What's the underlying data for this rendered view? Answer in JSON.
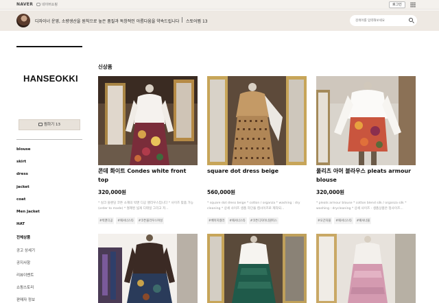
{
  "topbar": {
    "naver_label": "NAVER",
    "talk_label": "네이버쇼핑",
    "login_label": "로그인",
    "apps_icon": "grid-icon"
  },
  "header": {
    "description": "디자이너 운영, 소량생산을 원칙으로 높은 품질과 독창적인 아름다움을 약속드립니다",
    "follow_label": "스토어찜 13",
    "search_placeholder": "검색어를 입력해보세요",
    "search_icon": "search-icon"
  },
  "sidebar": {
    "brand": "HANSEOKKI",
    "favorite_label": "찜하기 13",
    "categories": [
      {
        "label": "blouse",
        "bold": true
      },
      {
        "label": "skirt",
        "bold": true
      },
      {
        "label": "dress",
        "bold": true
      },
      {
        "label": "jacket",
        "bold": true
      },
      {
        "label": "coat",
        "bold": true
      },
      {
        "label": "Men Jacket",
        "bold": true
      },
      {
        "label": "HAT",
        "bold": true
      },
      {
        "label": "전체상품",
        "bold": true
      },
      {
        "label": "공고 상세기",
        "bold": false
      },
      {
        "label": "공지사항",
        "bold": false
      },
      {
        "label": "리뷰이벤트",
        "bold": false
      },
      {
        "label": "쇼핑스토리",
        "bold": false
      },
      {
        "label": "판매자 정보",
        "bold": false
      }
    ]
  },
  "main": {
    "section_title": "신상품",
    "products": [
      {
        "title": "콘데 화이트 Condes white front top",
        "price": "320,000원",
        "body": "* 실크 블렌딩 코튼 소재의 빅맨 디공 앨리우스입니다 * 사이즈 맞춤 가능 (order to made) * 절제된 넓게 디테일 그리고 저...",
        "tags": [
          "#빅맨디공",
          "#패셔너스타",
          "#코튼블라우스여성"
        ]
      },
      {
        "title": "square dot dress beige",
        "price": "560,000원",
        "body": "* square dot dress beige * cotton / organza * washing : dry cleaning * 상세 사이즈 생품 하단을 캡사이즈로 제작되...",
        "tags": [
          "#베이지컬러",
          "#패셔너스타",
          "#코튼디자이너원피스"
        ]
      },
      {
        "title": "풀리츠 아머 블라우스 pleats armour blouse",
        "price": "320,000원",
        "body": "* pleats armour blouse * cotton blend silk / organza silk * washing : drycleaning * 상세 사이즈 - 생품상품은 정사이즈...",
        "tags": [
          "#오간자블",
          "#패셔너스타",
          "#패셔너블"
        ]
      },
      {
        "title": "",
        "price": "",
        "body": "",
        "tags": []
      },
      {
        "title": "",
        "price": "",
        "body": "",
        "tags": []
      },
      {
        "title": "",
        "price": "",
        "body": "",
        "tags": []
      }
    ]
  },
  "colors": {
    "topbar_bg": "#f4f1ed",
    "header_bg": "#eee9e3",
    "favorite_bg": "#e8e2da",
    "text": "#111111",
    "muted": "#999999"
  }
}
